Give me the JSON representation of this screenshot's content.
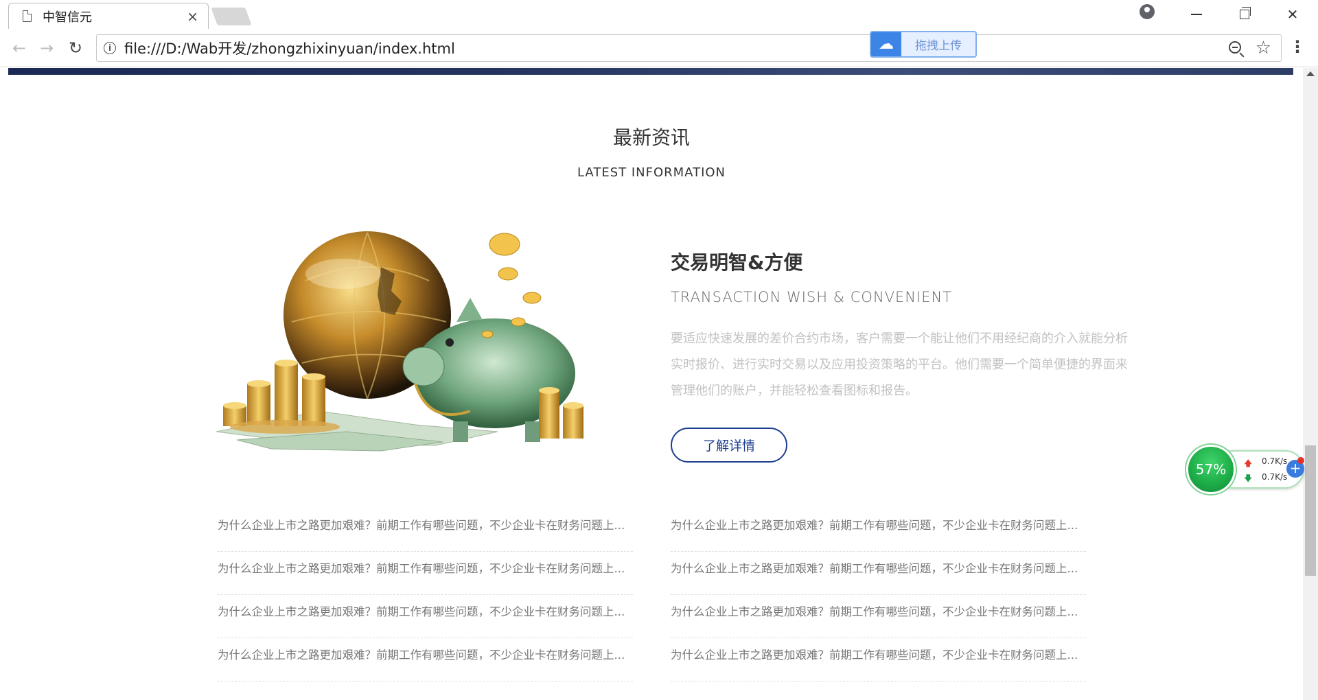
{
  "browser": {
    "tab_title": "中智信元",
    "tab_close": "×",
    "url": "file:///D:/Wab开发/zhongzhixinyuan/index.html",
    "upload_label": "拖拽上传",
    "menu_glyph": "⋮",
    "star_glyph": "☆",
    "info_glyph": "i"
  },
  "section": {
    "title": "最新资讯",
    "subtitle": "LATEST INFORMATION"
  },
  "feature": {
    "title": "交易明智&方便",
    "subtitle": "TRANSACTION WISH & CONVENIENT",
    "description": "要适应快速发展的差价合约市场，客户需要一个能让他们不用经纪商的介入就能分析实时报价、进行实时交易以及应用投资策略的平台。他们需要一个简单便捷的界面来管理他们的账户，并能轻松查看图标和报告。",
    "button_label": "了解详情"
  },
  "news": {
    "left": [
      "为什么企业上市之路更加艰难？前期工作有哪些问题，不少企业卡在财务问题上...",
      "为什么企业上市之路更加艰难？前期工作有哪些问题，不少企业卡在财务问题上...",
      "为什么企业上市之路更加艰难？前期工作有哪些问题，不少企业卡在财务问题上...",
      "为什么企业上市之路更加艰难？前期工作有哪些问题，不少企业卡在财务问题上..."
    ],
    "right": [
      "为什么企业上市之路更加艰难？前期工作有哪些问题，不少企业卡在财务问题上...",
      "为什么企业上市之路更加艰难？前期工作有哪些问题，不少企业卡在财务问题上...",
      "为什么企业上市之路更加艰难？前期工作有哪些问题，不少企业卡在财务问题上...",
      "为什么企业上市之路更加艰难？前期工作有哪些问题，不少企业卡在财务问题上..."
    ]
  },
  "net_widget": {
    "percent": "57%",
    "upload_speed": "0.7K/s",
    "download_speed": "0.7K/s"
  },
  "colors": {
    "accent": "#1c3d8f",
    "banner": "#1b2a55",
    "net_green": "#1cab46"
  }
}
